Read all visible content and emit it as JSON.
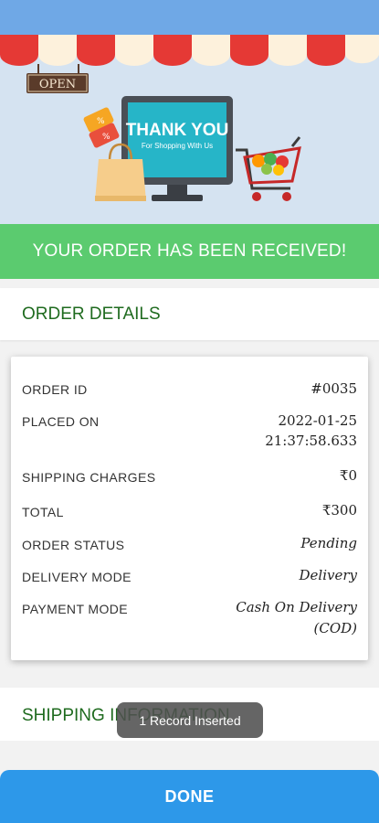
{
  "hero": {
    "open_sign": "OPEN",
    "thank_you": "THANK YOU",
    "subtitle": "For Shopping With Us"
  },
  "banner": {
    "text": "YOUR ORDER HAS BEEN RECEIVED!"
  },
  "order_details": {
    "title": "ORDER DETAILS",
    "rows": [
      {
        "label": "ORDER ID",
        "value": "#0035"
      },
      {
        "label": "PLACED ON",
        "value": "2022-01-25",
        "value2": "21:37:58.633"
      },
      {
        "label": "SHIPPING CHARGES",
        "value": "₹0"
      },
      {
        "label": "TOTAL",
        "value": "₹300"
      },
      {
        "label": "ORDER STATUS",
        "value": "Pending"
      },
      {
        "label": "DELIVERY MODE",
        "value": "Delivery"
      },
      {
        "label": "PAYMENT MODE",
        "value": "Cash On Delivery",
        "value2": "(COD)"
      }
    ]
  },
  "shipping": {
    "title": "SHIPPING INFORMATION"
  },
  "toast": {
    "text": "1 Record Inserted"
  },
  "done_button": {
    "label": "DONE"
  },
  "colors": {
    "status_bar": "#6fa8e6",
    "banner": "#5bcb6f",
    "section_title": "#1f6b1f",
    "done_button": "#2d98e9"
  }
}
